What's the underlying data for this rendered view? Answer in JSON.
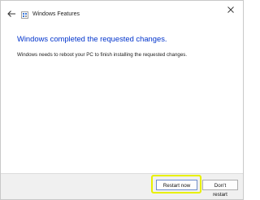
{
  "window": {
    "title": "Windows Features",
    "close_glyph": "✕"
  },
  "content": {
    "heading": "Windows completed the requested changes.",
    "message": "Windows needs to reboot your PC to finish installing the requested changes."
  },
  "buttons": {
    "restart_label": "Restart now",
    "dont_restart_label": "Don't restart"
  },
  "icons": {
    "back": "back-arrow-icon",
    "app": "windows-features-icon",
    "close": "close-icon"
  },
  "colors": {
    "heading": "#0033cc",
    "highlight": "#e8f000",
    "footer_bg": "#f0f0f0"
  }
}
